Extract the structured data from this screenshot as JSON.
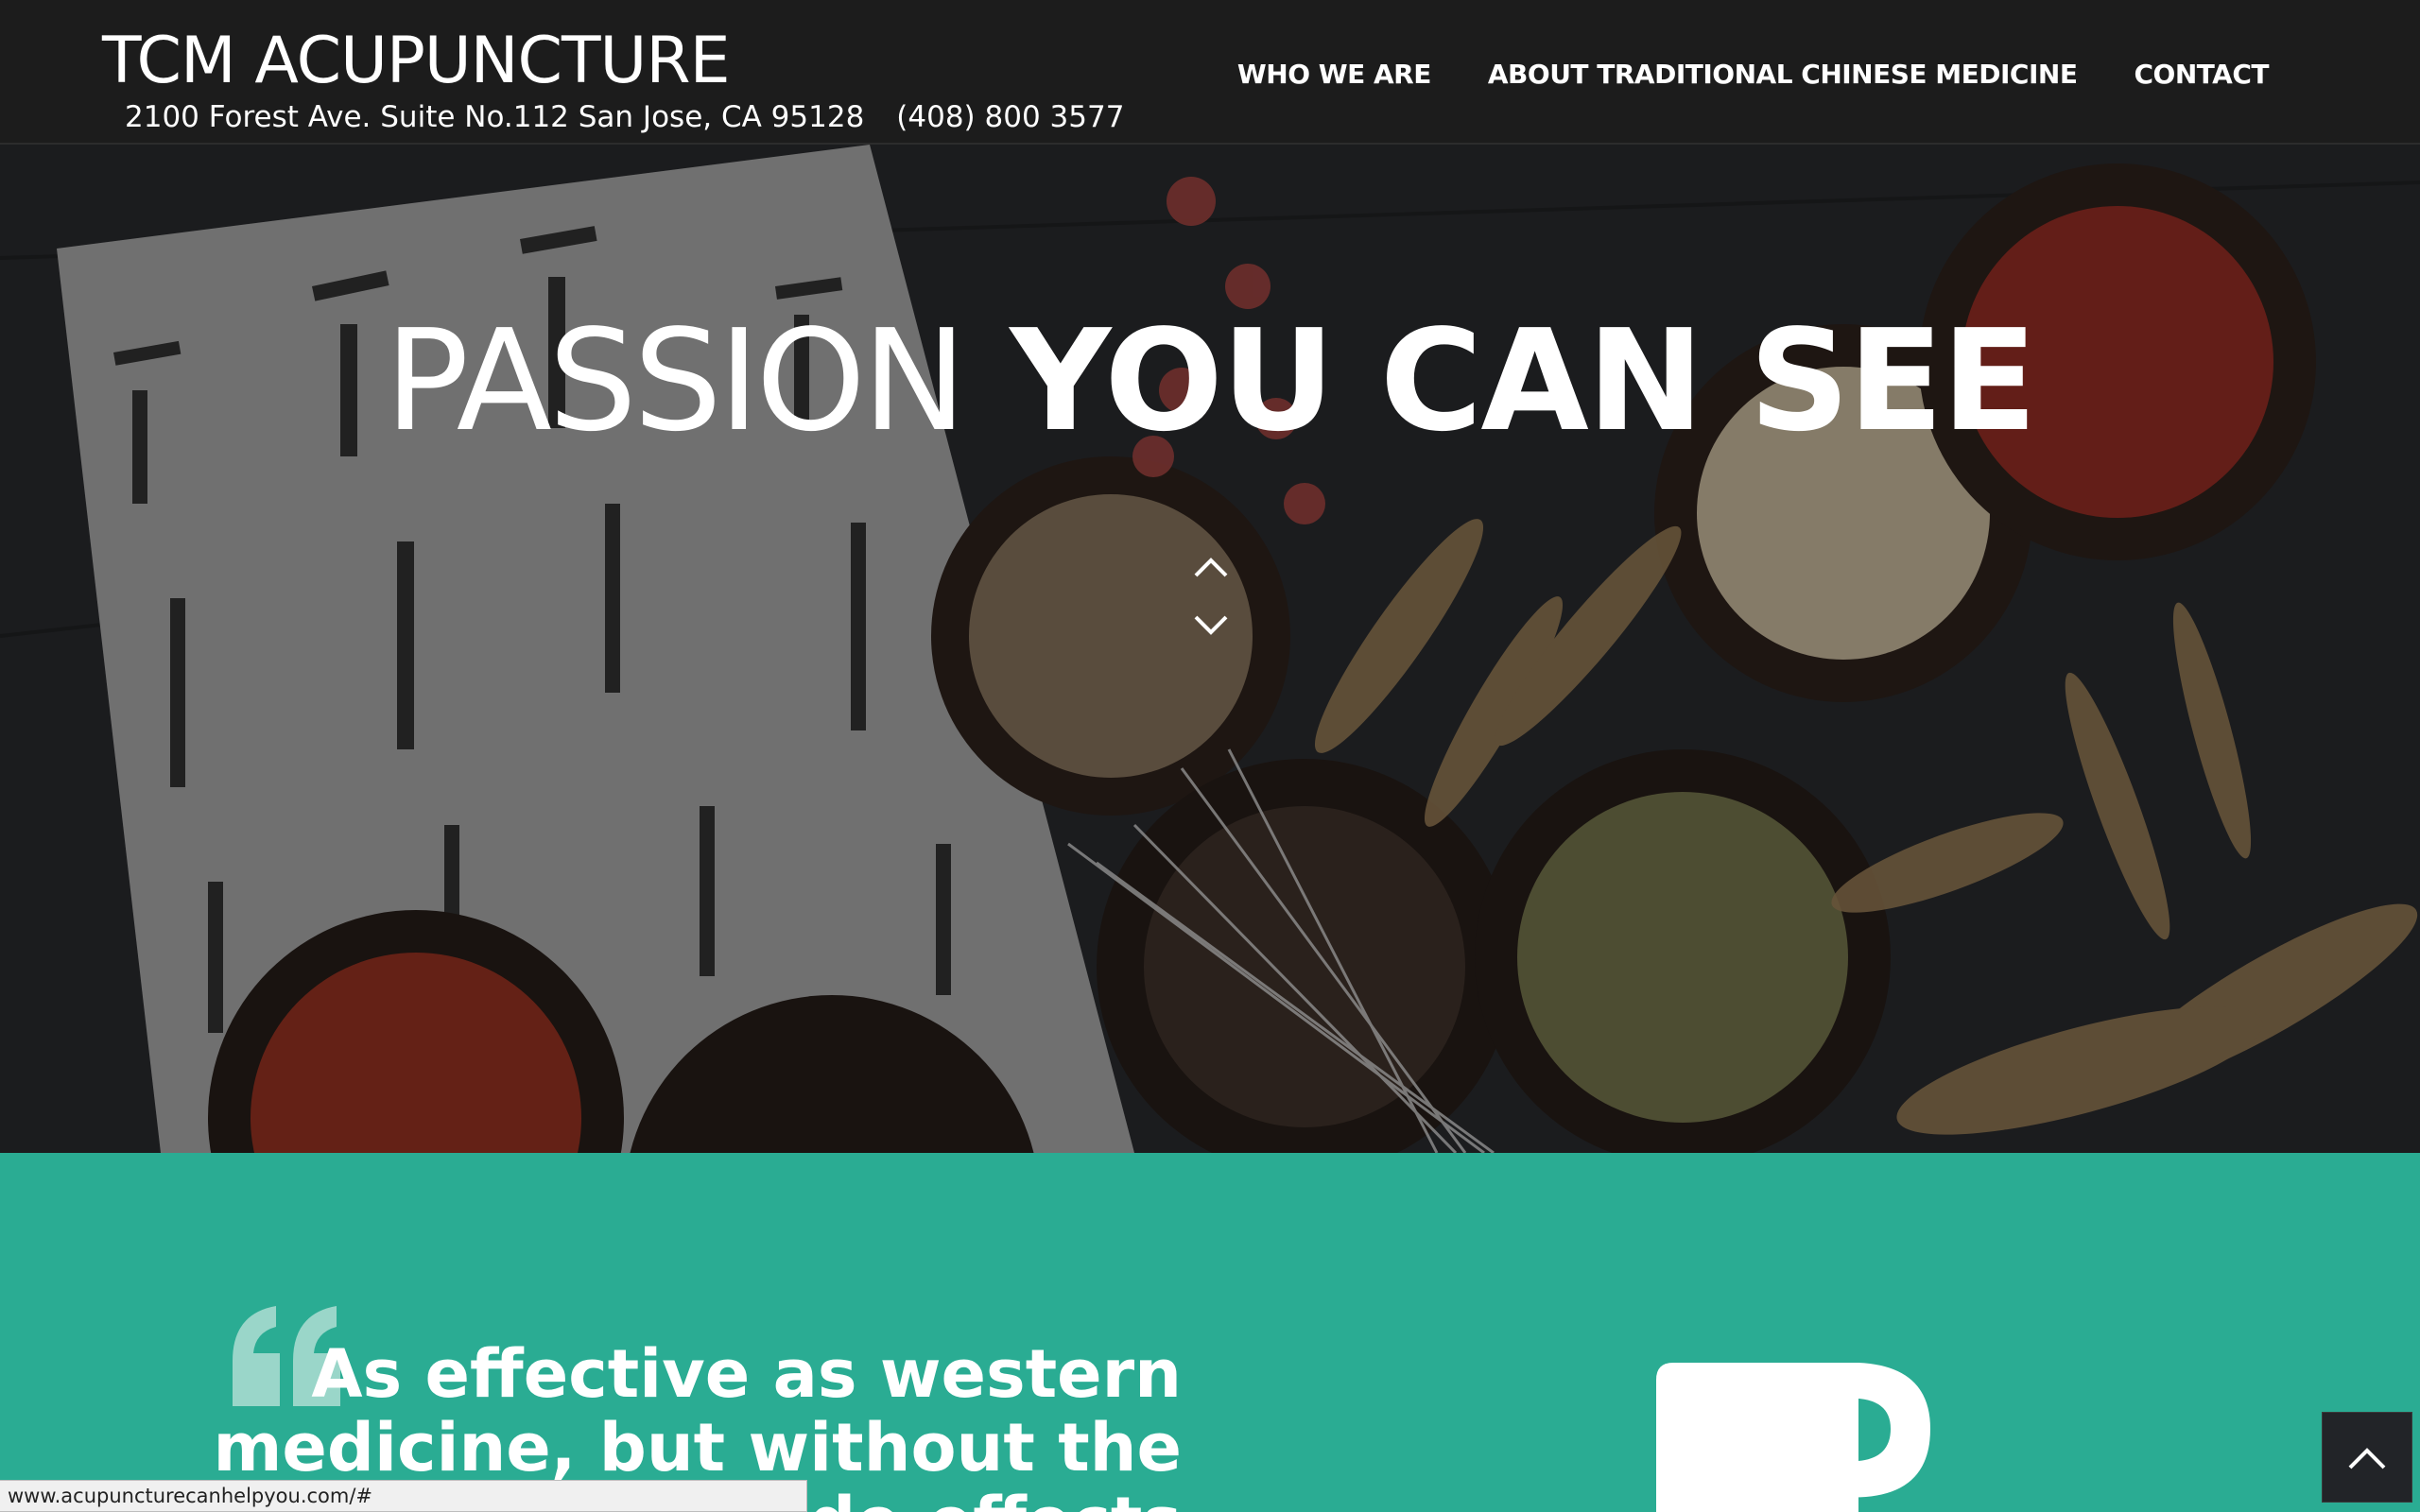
{
  "header": {
    "brand": "TCM ACUPUNCTURE",
    "address": "2100 Forest Ave. Suite No.112 San Jose, CA 95128",
    "phone": "(408) 800 3577",
    "nav": [
      {
        "label": "WHO WE ARE"
      },
      {
        "label": "ABOUT TRADITIONAL CHINESE MEDICINE"
      },
      {
        "label": "CONTACT"
      }
    ]
  },
  "hero": {
    "title_light": "PASSION",
    "title_bold": "YOU CAN SEE"
  },
  "feature": {
    "quote": "As effective as western medicine, but without the side-effects"
  },
  "status_bar": {
    "url": "www.acupuncturecanhelpyou.com/#"
  },
  "colors": {
    "header_bg": "#1c1c1c",
    "accent_green": "#2aac93",
    "quote_mark": "#9ad6c9"
  },
  "icons": {
    "scroll_up": "chevron-up-icon",
    "scroll_down": "chevron-down-icon",
    "quote": "quote-icon",
    "cup": "coffee-cup-icon",
    "back_to_top": "chevron-up-icon"
  }
}
